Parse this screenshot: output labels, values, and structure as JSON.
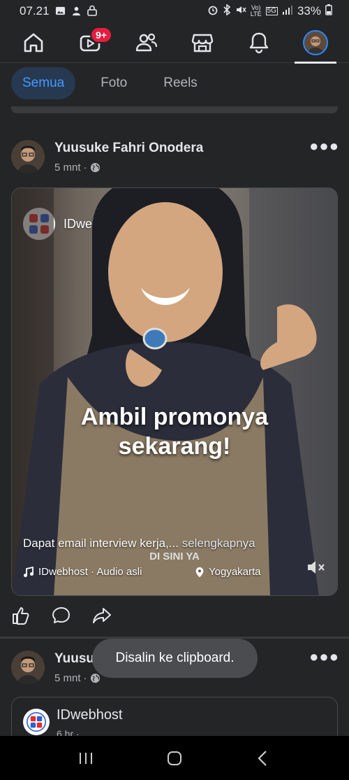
{
  "status_bar": {
    "time": "07.21",
    "battery": "33%",
    "network": "5G",
    "lte": "LTE"
  },
  "nav": {
    "notification_badge": "9+",
    "items": [
      "home-icon",
      "video-icon",
      "friends-icon",
      "marketplace-icon",
      "bell-icon",
      "profile-avatar"
    ]
  },
  "filters": {
    "items": [
      {
        "label": "Semua",
        "active": true
      },
      {
        "label": "Foto",
        "active": false
      },
      {
        "label": "Reels",
        "active": false
      }
    ]
  },
  "post1": {
    "author": "Yuusuke Fahri Onodera",
    "time": "5 mnt",
    "separator": "·",
    "media": {
      "page_name": "IDwebhost",
      "overlay_line1": "Ambil promonya",
      "overlay_line2": "sekarang!",
      "bottom_text": "DI SINI YA",
      "caption": "Dapat email interview kerja,...",
      "see_more": "selengkapnya",
      "audio": "IDwebhost · Audio asli",
      "location": "Yogyakarta"
    }
  },
  "post2": {
    "author_visible": "Yuusu",
    "time": "5 mnt",
    "separator": "·",
    "card": {
      "page_name": "IDwebhost",
      "time": "6 hr",
      "separator": "·"
    }
  },
  "toast": {
    "message": "Disalin ke clipboard."
  },
  "colors": {
    "background": "#242526",
    "accent": "#4599ff",
    "badge": "#e41e3f"
  }
}
